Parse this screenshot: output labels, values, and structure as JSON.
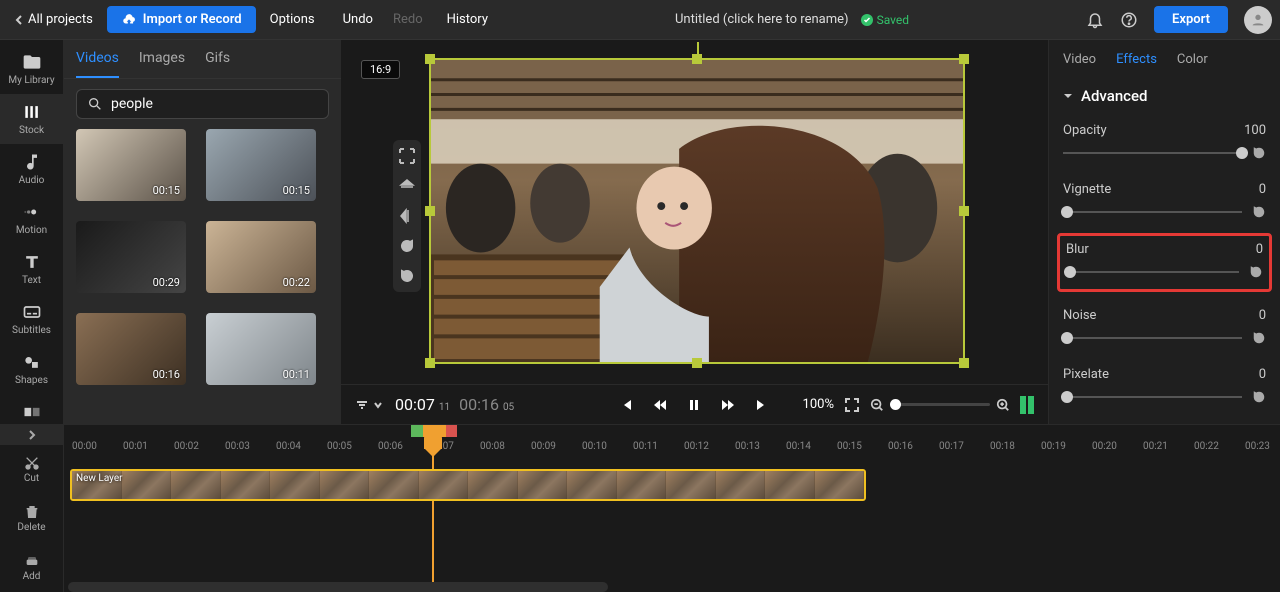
{
  "topbar": {
    "all_projects": "All projects",
    "import": "Import or Record",
    "options": "Options",
    "undo": "Undo",
    "redo": "Redo",
    "history": "History",
    "title": "Untitled (click here to rename)",
    "saved": "Saved",
    "export": "Export"
  },
  "rail": {
    "myLibrary": "My Library",
    "stock": "Stock",
    "audio": "Audio",
    "motion": "Motion",
    "text": "Text",
    "subtitles": "Subtitles",
    "shapes": "Shapes",
    "transitions": "Transitions"
  },
  "stock": {
    "tabs": {
      "videos": "Videos",
      "images": "Images",
      "gifs": "Gifs"
    },
    "searchValue": "people",
    "items": [
      {
        "dur": "00:15"
      },
      {
        "dur": "00:15"
      },
      {
        "dur": "00:29"
      },
      {
        "dur": "00:22"
      },
      {
        "dur": "00:16"
      },
      {
        "dur": "00:11"
      }
    ]
  },
  "canvas": {
    "aspect": "16:9"
  },
  "playbar": {
    "cur": "00:07",
    "curSub": "11",
    "tot": "00:16",
    "totSub": "05",
    "zoom": "100%"
  },
  "side": {
    "tabs": {
      "video": "Video",
      "effects": "Effects",
      "color": "Color"
    },
    "section": "Advanced",
    "opacity": {
      "label": "Opacity",
      "value": "100"
    },
    "vignette": {
      "label": "Vignette",
      "value": "0"
    },
    "blur": {
      "label": "Blur",
      "value": "0"
    },
    "noise": {
      "label": "Noise",
      "value": "0"
    },
    "pixelate": {
      "label": "Pixelate",
      "value": "0"
    }
  },
  "tlrail": {
    "cut": "Cut",
    "delete": "Delete",
    "add": "Add"
  },
  "timeline": {
    "marks": [
      "00:00",
      "00:01",
      "00:02",
      "00:03",
      "00:04",
      "00:05",
      "00:06",
      "00:07",
      "00:08",
      "00:09",
      "00:10",
      "00:11",
      "00:12",
      "00:13",
      "00:14",
      "00:15",
      "00:16",
      "00:17",
      "00:18",
      "00:19",
      "00:20",
      "00:21",
      "00:22",
      "00:23"
    ],
    "clipLabel": "New Layer"
  }
}
